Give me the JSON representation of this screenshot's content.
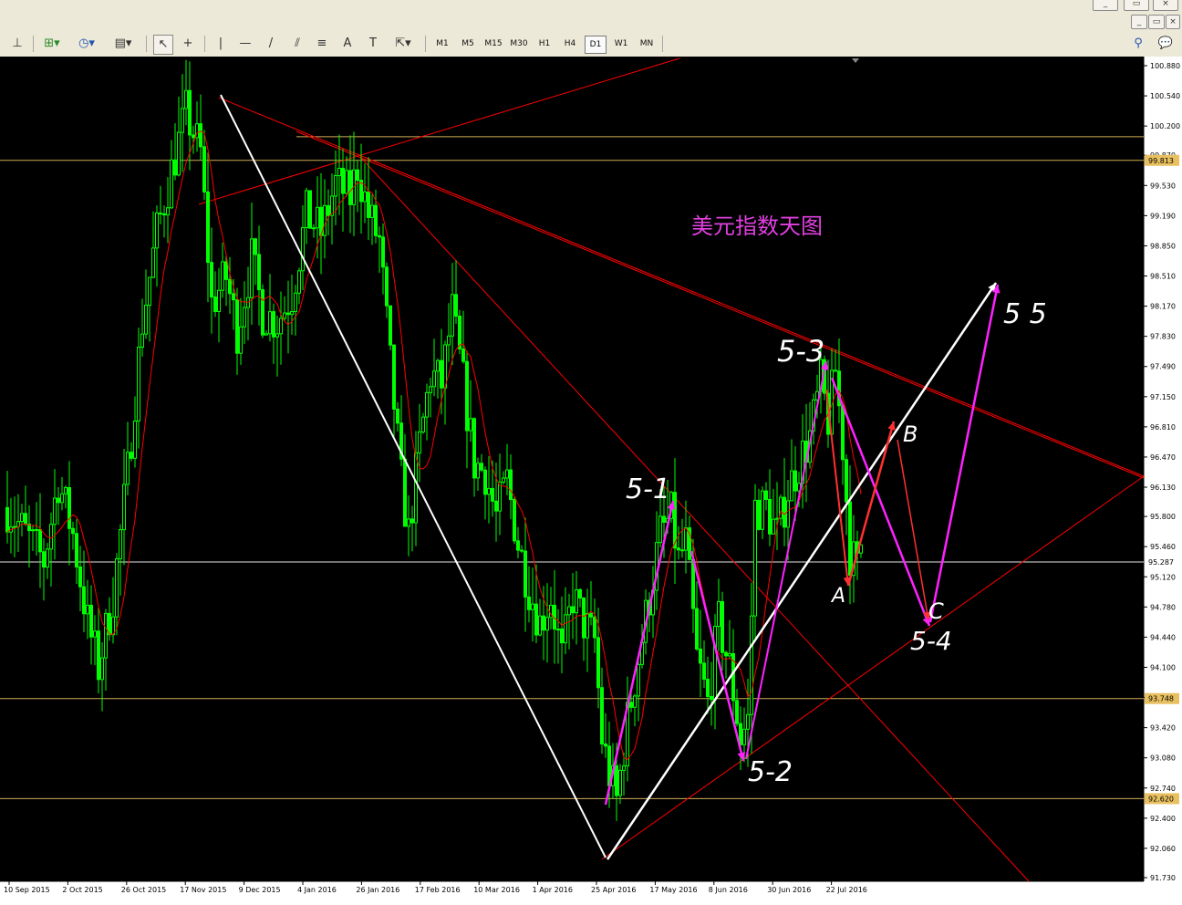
{
  "window_controls": [
    "minimize-icon",
    "restore-icon",
    "close-icon"
  ],
  "toolbar": {
    "tools": [
      {
        "name": "vertical-line-tool-icon",
        "glyph": "|"
      },
      {
        "name": "horizontal-line-tool-icon",
        "glyph": "—"
      },
      {
        "name": "trendline-tool-icon",
        "glyph": "/"
      },
      {
        "name": "text-tool-icon",
        "glyph": "A"
      },
      {
        "name": "text-label-tool-icon",
        "glyph": "T"
      }
    ],
    "timeframes": [
      "M1",
      "M5",
      "M15",
      "M30",
      "H1",
      "H4",
      "D1",
      "W1",
      "MN"
    ],
    "active_timeframe": "D1"
  },
  "chart_data": {
    "type": "candlestick",
    "title": "美元指数天图",
    "price_axis": {
      "ticks": [
        "100.880",
        "100.540",
        "100.200",
        "99.870",
        "99.530",
        "99.190",
        "98.850",
        "98.510",
        "98.170",
        "97.830",
        "97.490",
        "97.150",
        "96.810",
        "96.470",
        "96.130",
        "95.800",
        "95.460",
        "95.120",
        "94.780",
        "94.440",
        "94.100",
        "93.760",
        "93.420",
        "93.080",
        "92.740",
        "92.400",
        "92.060",
        "91.730"
      ],
      "range": [
        91.73,
        100.88
      ]
    },
    "date_axis": {
      "ticks": [
        "10 Sep 2015",
        "2 Oct 2015",
        "26 Oct 2015",
        "17 Nov 2015",
        "9 Dec 2015",
        "4 Jan 2016",
        "26 Jan 2016",
        "17 Feb 2016",
        "10 Mar 2016",
        "1 Apr 2016",
        "25 Apr 2016",
        "17 May 2016",
        "8 Jun 2016",
        "30 Jun 2016",
        "22 Jul 2016"
      ]
    },
    "price_markers": [
      {
        "value": "99.813",
        "color": "#e8c060"
      },
      {
        "value": "95.287",
        "color": "#ffffff"
      },
      {
        "value": "93.748",
        "color": "#e8c060"
      },
      {
        "value": "92.620",
        "color": "#e8c060"
      }
    ],
    "wave_labels": [
      "5-1",
      "5-2",
      "5-3",
      "5-4",
      "5-5",
      "A",
      "B",
      "C"
    ],
    "colors": {
      "background": "#000000",
      "candles": "#00ff00",
      "moving_average": "#ff0000",
      "trendlines": "#ff0000",
      "waves_major": "#ffffff",
      "waves_impulse": "#ff22ff",
      "waves_correction": "#ff3030",
      "title": "#e040e0"
    }
  }
}
